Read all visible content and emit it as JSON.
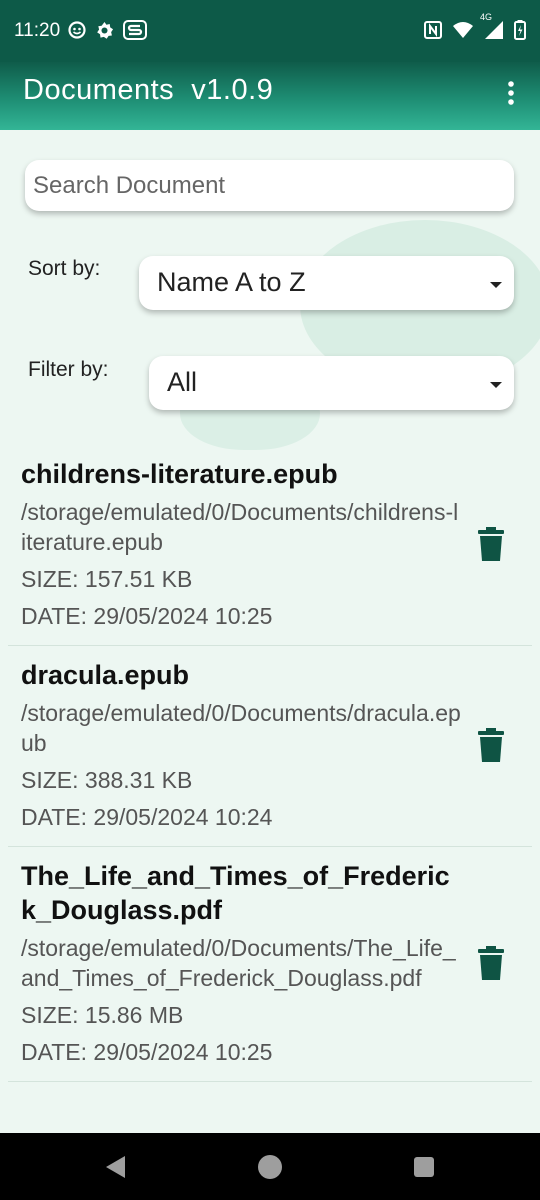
{
  "status_bar": {
    "time": "11:20",
    "left_icons": [
      "emoji-icon",
      "settings-icon",
      "s-app-icon"
    ],
    "right_icons": [
      "nfc-icon",
      "wifi-icon",
      "signal-4g-icon",
      "battery-icon"
    ],
    "network_label": "4G"
  },
  "app_bar": {
    "title": "Documents  v1.0.9",
    "menu_icon": "more-vert-icon"
  },
  "search": {
    "placeholder": "Search Document",
    "value": ""
  },
  "sort": {
    "label": "Sort by:",
    "selected": "Name A to Z"
  },
  "filter": {
    "label": "Filter by:",
    "selected": "All"
  },
  "documents": [
    {
      "name": "childrens-literature.epub",
      "path": "/storage/emulated/0/Documents/childrens-literature.epub",
      "size": "SIZE: 157.51 KB",
      "date": "DATE: 29/05/2024 10:25"
    },
    {
      "name": "dracula.epub",
      "path": "/storage/emulated/0/Documents/dracula.epub",
      "size": "SIZE: 388.31 KB",
      "date": "DATE: 29/05/2024 10:24"
    },
    {
      "name": "The_Life_and_Times_of_Frederick_Douglass.pdf",
      "path": "/storage/emulated/0/Documents/The_Life_and_Times_of_Frederick_Douglass.pdf",
      "size": "SIZE: 15.86 MB",
      "date": "DATE: 29/05/2024 10:25"
    }
  ],
  "colors": {
    "primary_dark": "#0d5a48",
    "accent": "#1e8e74",
    "trash_icon": "#0f5444",
    "background": "#edf7f2"
  },
  "nav_bar": {
    "buttons": [
      "back-icon",
      "home-icon",
      "recents-icon"
    ]
  }
}
